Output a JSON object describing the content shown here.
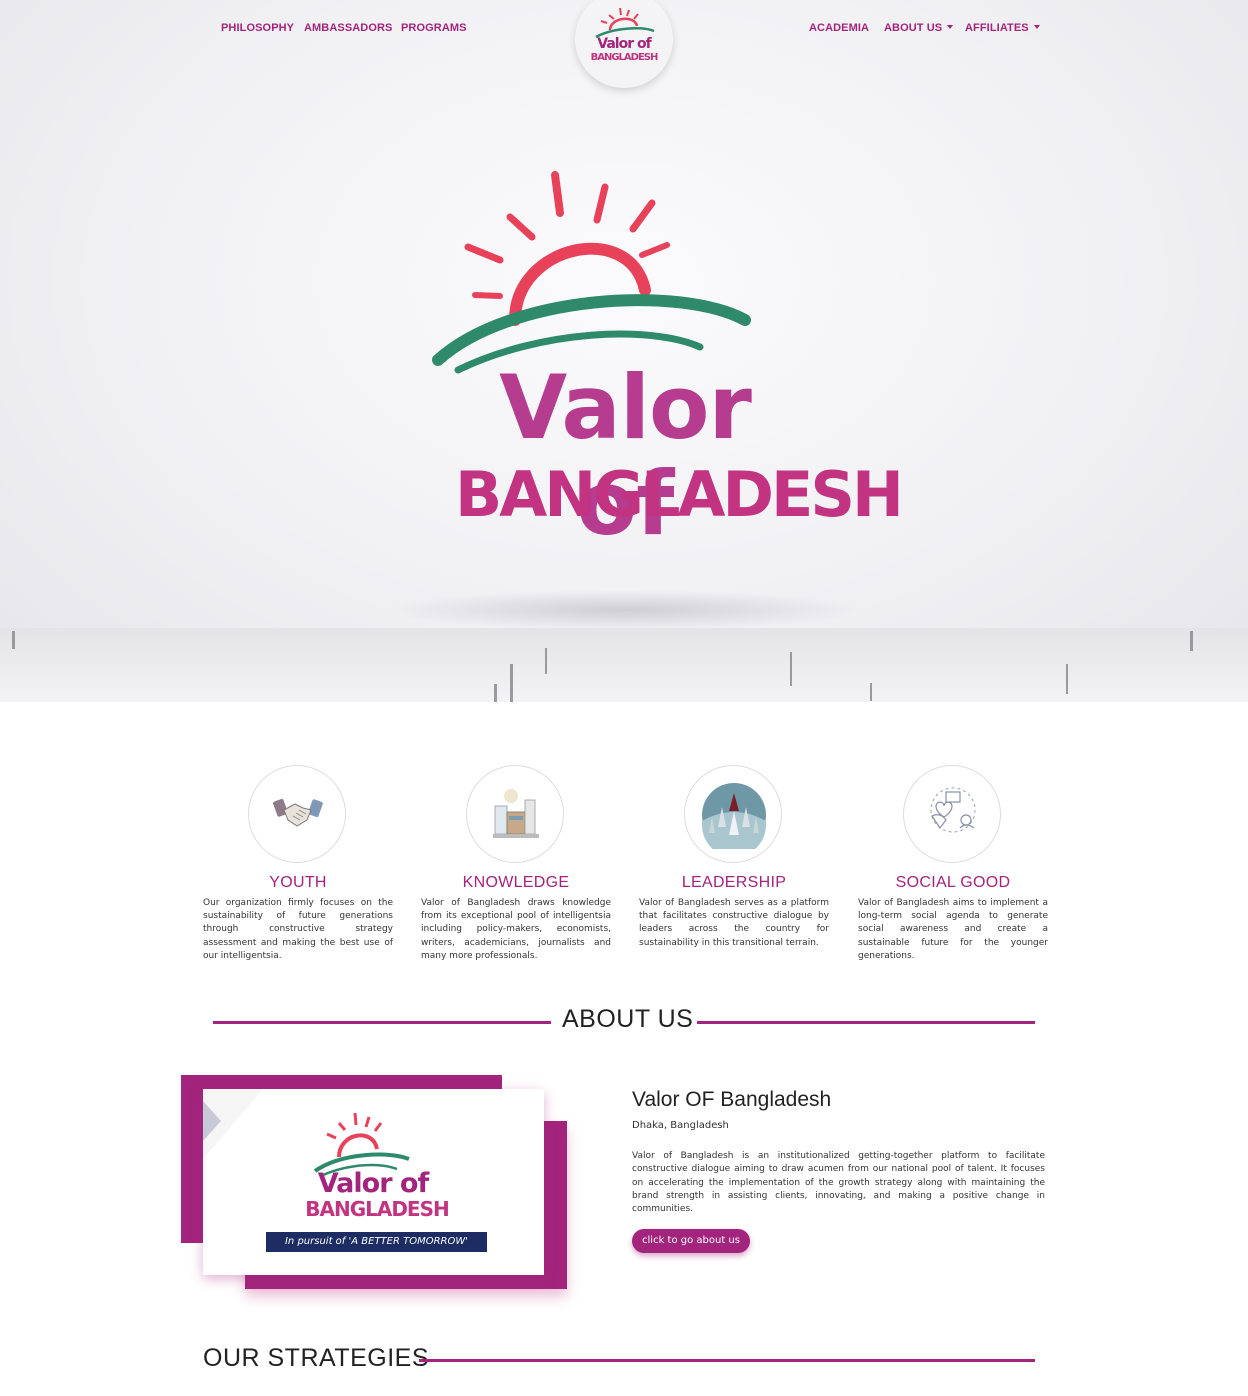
{
  "nav": {
    "left": [
      {
        "label": "PHILOSOPHY"
      },
      {
        "label": "AMBASSADORS"
      },
      {
        "label": "PROGRAMS"
      }
    ],
    "right": [
      {
        "label": "ACADEMIA"
      },
      {
        "label": "ABOUT US"
      },
      {
        "label": "AFFILIATES"
      }
    ],
    "logo": {
      "line1": "Valor of",
      "line2": "BANGLADESH"
    }
  },
  "hero": {
    "logo": {
      "line1": "Valor of",
      "line2": "BANGLADESH"
    }
  },
  "features": [
    {
      "title": "YOUTH",
      "icon": "handshake-icon",
      "text": "Our organization firmly focuses on the sustainability of future generations through constructive strategy assessment and making the best use of our intelligentsia."
    },
    {
      "title": "KNOWLEDGE",
      "icon": "books-lamp-icon",
      "text": "Valor of Bangladesh draws knowledge from its exceptional pool of intelligentsia including policy-makers, economists, writers, academicians, journalists and many more professionals."
    },
    {
      "title": "LEADERSHIP",
      "icon": "pencils-icon",
      "text": "Valor of Bangladesh serves as a platform that facilitates constructive dialogue by leaders across the country for sustainability in this transitional terrain."
    },
    {
      "title": "SOCIAL GOOD",
      "icon": "charity-hands-icon",
      "text": "Valor of Bangladesh aims to implement a long-term social agenda to generate social awareness and create a sustainable future for the younger generations."
    }
  ],
  "about": {
    "heading": "ABOUT US",
    "card": {
      "line1": "Valor of",
      "line2": "BANGLADESH",
      "tagline_prefix": "In pursuit of",
      "tagline_quote": "'A BETTER TOMORROW'"
    },
    "name": "Valor OF Bangladesh",
    "location": "Dhaka, Bangladesh",
    "description": "Valor of Bangladesh is an institutionalized getting-together platform to facilitate constructive dialogue aiming to draw acumen from our national pool of talent. It focuses on accelerating the implementation of the growth strategy along with maintaining the brand strength in assisting clients, innovating, and making a positive change in communities.",
    "button_label": "click to go about us"
  },
  "strategies": {
    "heading": "OUR STRATEGIES"
  },
  "colors": {
    "brand": "#a3247c",
    "navy": "#1d2c63",
    "green": "#2e8a6a",
    "sun": "#e8425a"
  }
}
